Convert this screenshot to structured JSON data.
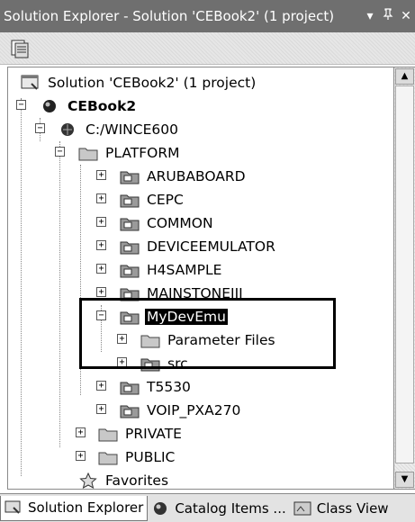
{
  "window": {
    "title": "Solution Explorer - Solution 'CEBook2' (1 project)",
    "dropdown_glyph": "▾",
    "pin_glyph": "ᵖ",
    "close_glyph": "✕"
  },
  "toolbar": {
    "properties_icon": "properties-icon"
  },
  "tree": [
    {
      "label": "Solution 'CEBook2' (1 project)",
      "icon": "solution-icon"
    },
    {
      "label": "CEBook2",
      "icon": "project-icon",
      "bold": true
    },
    {
      "label": "C:/WINCE600",
      "icon": "platform-root-icon"
    },
    {
      "label": "PLATFORM",
      "icon": "folder-icon"
    },
    {
      "label": "ARUBABOARD",
      "icon": "bsp-folder-icon"
    },
    {
      "label": "CEPC",
      "icon": "bsp-folder-icon"
    },
    {
      "label": "COMMON",
      "icon": "bsp-folder-icon"
    },
    {
      "label": "DEVICEEMULATOR",
      "icon": "bsp-folder-icon"
    },
    {
      "label": "H4SAMPLE",
      "icon": "bsp-folder-icon"
    },
    {
      "label": "MAINSTONEIII",
      "icon": "bsp-folder-icon"
    },
    {
      "label": "MyDevEmu",
      "icon": "bsp-folder-icon",
      "selected": true
    },
    {
      "label": "Parameter Files",
      "icon": "folder-icon"
    },
    {
      "label": "src",
      "icon": "bsp-folder-icon"
    },
    {
      "label": "T5530",
      "icon": "bsp-folder-icon"
    },
    {
      "label": "VOIP_PXA270",
      "icon": "bsp-folder-icon"
    },
    {
      "label": "PRIVATE",
      "icon": "folder-icon"
    },
    {
      "label": "PUBLIC",
      "icon": "folder-icon"
    },
    {
      "label": "Favorites",
      "icon": "favorites-star-icon"
    }
  ],
  "tabs": [
    {
      "label": "Solution Explorer",
      "icon": "solution-explorer-icon",
      "active": true
    },
    {
      "label": "Catalog Items ...",
      "icon": "catalog-icon"
    },
    {
      "label": "Class View",
      "icon": "class-view-icon"
    }
  ],
  "colors": {
    "titlebar_bg": "#6f6f6f",
    "selection_bg": "#000000",
    "selection_text": "#ffffff"
  }
}
